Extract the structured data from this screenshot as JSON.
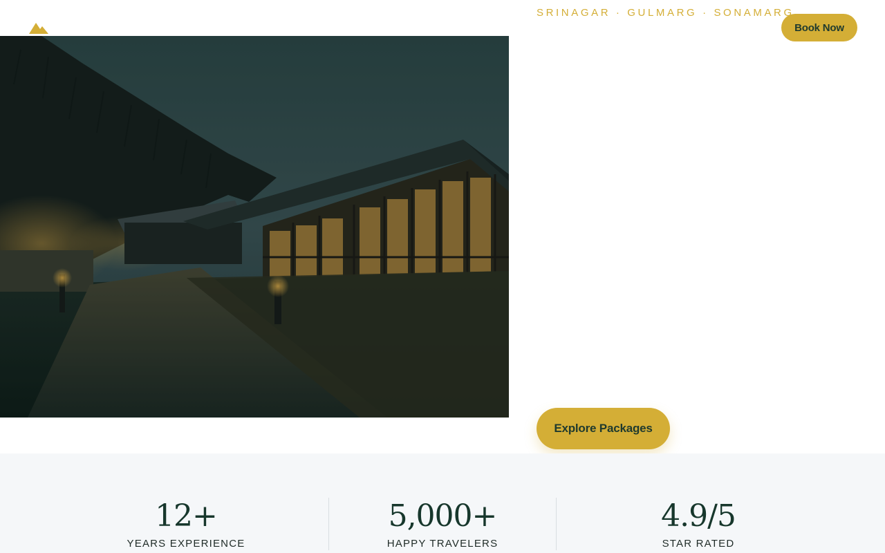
{
  "header": {
    "tagline": "SRINAGAR · GULMARG · SONAMARG",
    "book_button": "Book Now",
    "logo_icon": "mountain-icon",
    "accent_color": "#d4ae36"
  },
  "hero": {
    "image": "lodge-at-dusk",
    "explore_button": "Explore Packages"
  },
  "stats": [
    {
      "value": "12+",
      "label": "YEARS EXPERIENCE"
    },
    {
      "value": "5,000+",
      "label": "HAPPY TRAVELERS"
    },
    {
      "value": "4.9/5",
      "label": "STAR RATED"
    }
  ]
}
